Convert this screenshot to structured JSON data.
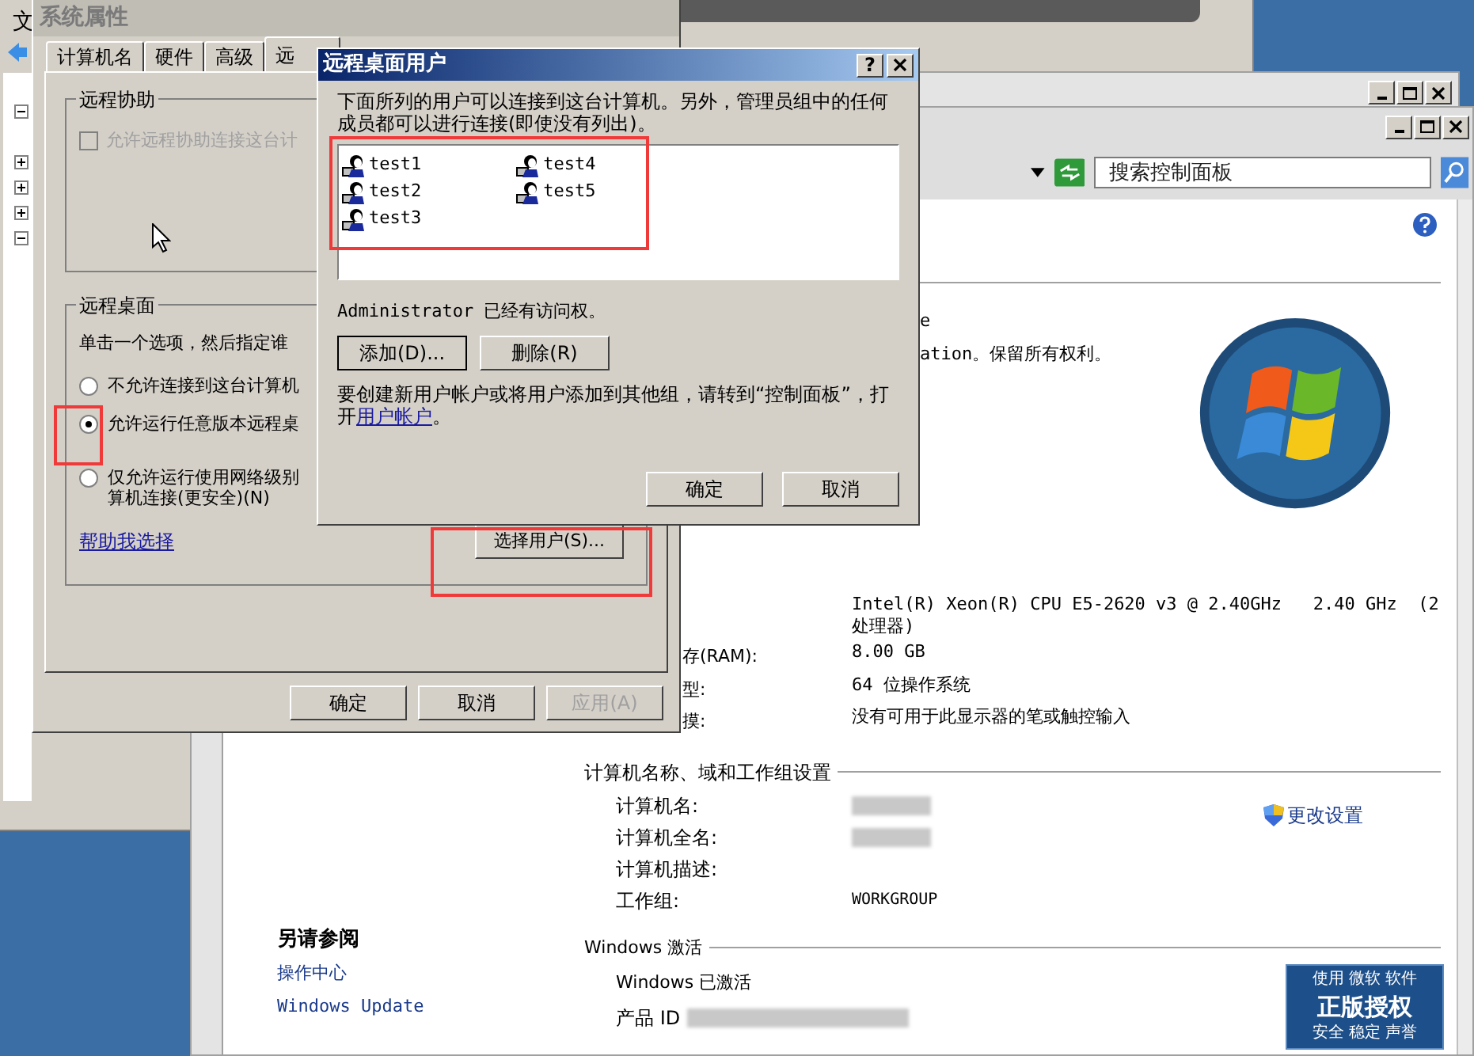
{
  "back_window": {
    "menu_letter": "文",
    "tree": [
      {
        "expanded": true
      },
      {
        "expanded": false
      },
      {
        "expanded": false
      },
      {
        "expanded": false
      },
      {
        "expanded": true
      }
    ]
  },
  "system_properties": {
    "title": "系统属性",
    "tabs": [
      {
        "label": "计算机名",
        "selected": false
      },
      {
        "label": "硬件",
        "selected": false
      },
      {
        "label": "高级",
        "selected": false
      },
      {
        "label": "远",
        "selected": true
      }
    ],
    "remote_assistance": {
      "title": "远程协助",
      "checkbox": {
        "label": "允许远程协助连接这台计",
        "checked": false,
        "disabled": true
      }
    },
    "remote_desktop": {
      "title": "远程桌面",
      "instruction": "单击一个选项，然后指定谁",
      "options": [
        {
          "lines": [
            "不允许连接到这台计算机"
          ],
          "selected": false
        },
        {
          "lines": [
            "允许运行任意版本远程桌"
          ],
          "selected": true
        },
        {
          "lines": [
            "仅允许运行使用网络级别",
            "算机连接(更安全)(N)"
          ],
          "selected": false
        }
      ],
      "help_link": "帮助我选择",
      "select_users_button": "选择用户(S)..."
    },
    "buttons": [
      {
        "label": "确定",
        "disabled": false
      },
      {
        "label": "取消",
        "disabled": false
      },
      {
        "label": "应用(A)",
        "disabled": true
      }
    ]
  },
  "remote_desktop_users": {
    "title": "远程桌面用户",
    "help_glyph": "?",
    "description": "下面所列的用户可以连接到这台计算机。另外，管理员组中的任何成员都可以进行连接(即使没有列出)。",
    "users": [
      "test1",
      "test2",
      "test3",
      "test4",
      "test5"
    ],
    "access_note": "Administrator 已经有访问权。",
    "list_buttons": [
      "添加(D)...",
      "删除(R)"
    ],
    "hint": "要创建新用户帐户或将用户添加到其他组，请转到“控制面板”，打开",
    "hint_link": "用户帐户",
    "hint_end": "。",
    "buttons": [
      "确定",
      "取消"
    ]
  },
  "control_panel": {
    "search": {
      "placeholder": "搜索控制面板"
    },
    "copyright_lines": [
      "e",
      "ation。保留所有权利。"
    ],
    "system_rows": [
      {
        "label": "",
        "value": "Intel(R) Xeon(R) CPU E5-2620 v3 @ 2.40GHz   2.40 GHz  (2 处理器)"
      },
      {
        "label": "存(RAM):",
        "value": "8.00 GB"
      },
      {
        "label": "型:",
        "value": "64 位操作系统"
      },
      {
        "label": "摸:",
        "value": "没有可用于此显示器的笔或触控输入"
      }
    ],
    "name_section": {
      "title": "计算机名称、域和工作组设置",
      "change_link": "更改设置",
      "rows": [
        {
          "label": "计算机名:",
          "value": "",
          "redacted": true
        },
        {
          "label": "计算机全名:",
          "value": "",
          "redacted": true
        },
        {
          "label": "计算机描述:",
          "value": "",
          "redacted": false
        },
        {
          "label": "工作组:",
          "value": "WORKGROUP",
          "redacted": false
        }
      ]
    },
    "activation": {
      "title": "Windows 激活",
      "status": "Windows 已激活",
      "product_id_label": "产品 ID",
      "product_id_redacted": true
    },
    "genuine_badge": {
      "top": "使用 微软 软件",
      "main": "正版授权",
      "bottom": "安全 稳定 声誉"
    },
    "see_also": {
      "title": "另请参阅",
      "links": [
        "操作中心",
        "Windows Update"
      ]
    }
  }
}
